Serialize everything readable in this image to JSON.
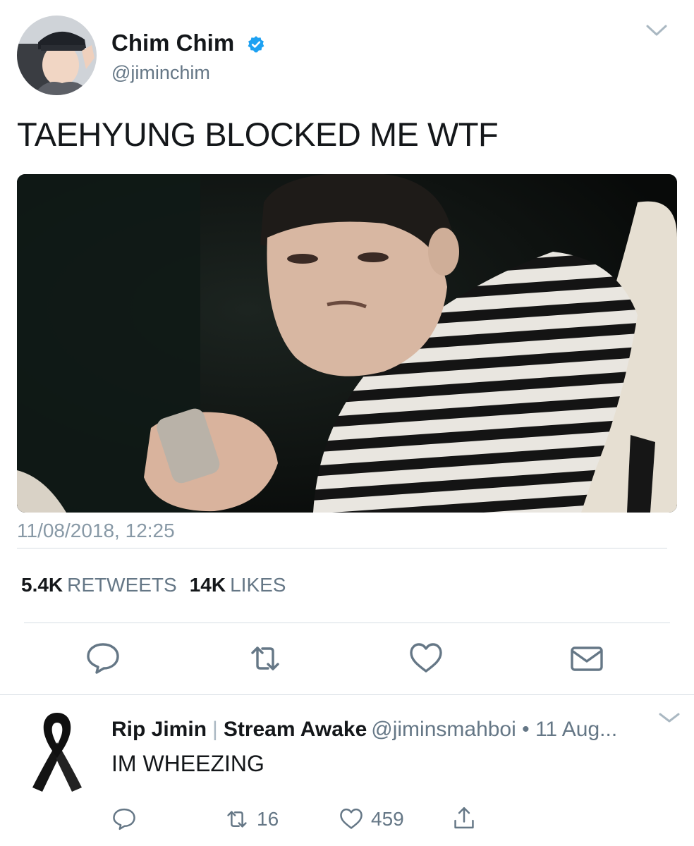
{
  "tweet": {
    "display_name": "Chim Chim",
    "handle": "@jiminchim",
    "text": "TAEHYUNG BLOCKED ME WTF",
    "timestamp": "11/08/2018, 12:25",
    "retweets_count": "5.4K",
    "retweets_label": "RETWEETS",
    "likes_count": "14K",
    "likes_label": "LIKES",
    "icons": [
      "verified-badge-icon",
      "caret-down-icon",
      "reply-icon",
      "retweet-icon",
      "heart-icon",
      "envelope-icon"
    ]
  },
  "reply": {
    "display_name": "Rip Jimin",
    "separator": "|",
    "display_name_2": "Stream Awake",
    "handle_time": "@jiminsmahboi • 11 Aug...",
    "text": "IM WHEEZING",
    "retweet_count": "16",
    "like_count": "459",
    "icons": [
      "black-ribbon-icon",
      "reply-icon",
      "retweet-icon",
      "heart-icon",
      "share-icon"
    ]
  },
  "colors": {
    "text": "#14171a",
    "secondary": "#657786",
    "verified": "#1da1f2",
    "divider": "#d6dde3"
  }
}
